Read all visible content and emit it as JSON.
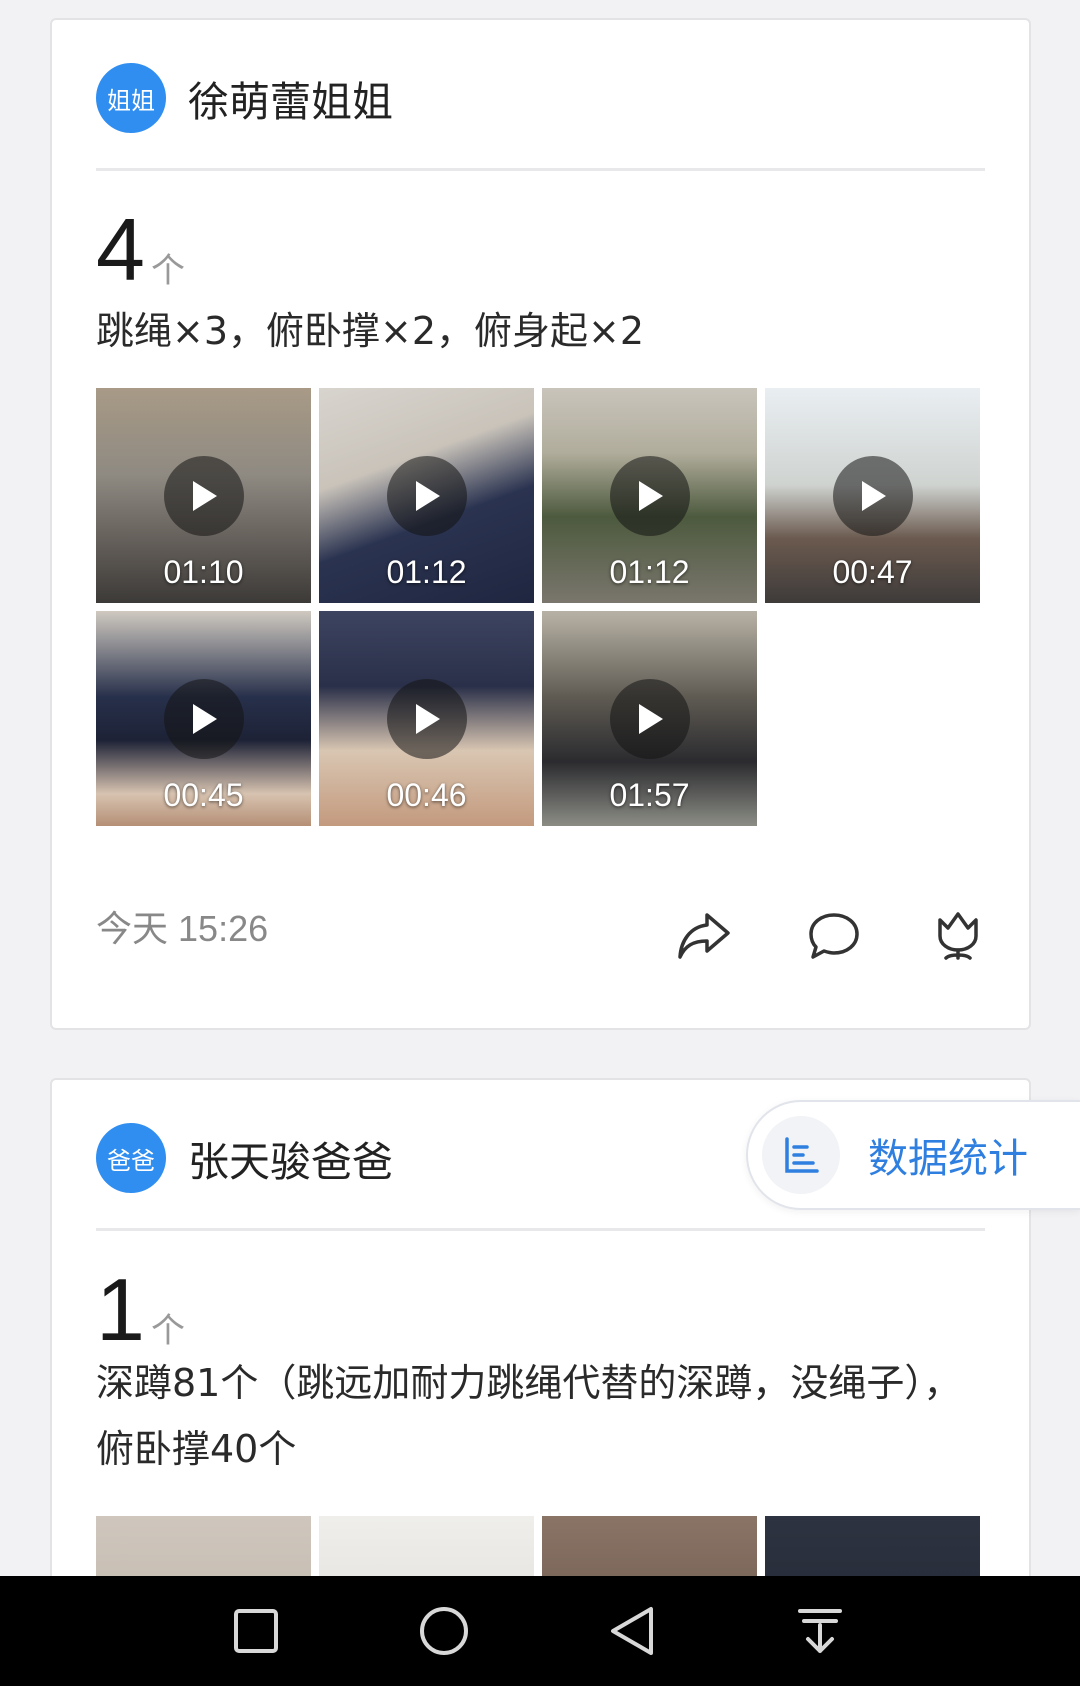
{
  "posts": [
    {
      "avatar_label": "姐姐",
      "author": "徐萌蕾姐姐",
      "count": "4",
      "count_unit": "个",
      "description": "跳绳×3，俯卧撑×2，俯身起×2",
      "videos": [
        {
          "duration": "01:10"
        },
        {
          "duration": "01:12"
        },
        {
          "duration": "01:12"
        },
        {
          "duration": "00:47"
        },
        {
          "duration": "00:45"
        },
        {
          "duration": "00:46"
        },
        {
          "duration": "01:57"
        }
      ],
      "time_day": "今天",
      "time_clock": "15:26"
    },
    {
      "avatar_label": "爸爸",
      "author": "张天骏爸爸",
      "count": "1",
      "count_unit": "个",
      "description": "深蹲81个（跳远加耐力跳绳代替的深蹲，没绳子），俯卧撑40个"
    }
  ],
  "stats_button": {
    "label": "数据统计"
  },
  "icons": {
    "share": "share-icon",
    "comment": "comment-icon",
    "flower": "flower-icon",
    "play": "play-icon",
    "stats": "bar-chart-icon"
  },
  "colors": {
    "accent": "#2f8ef0",
    "stats_text": "#2f7fe0",
    "background": "#f2f2f4"
  }
}
